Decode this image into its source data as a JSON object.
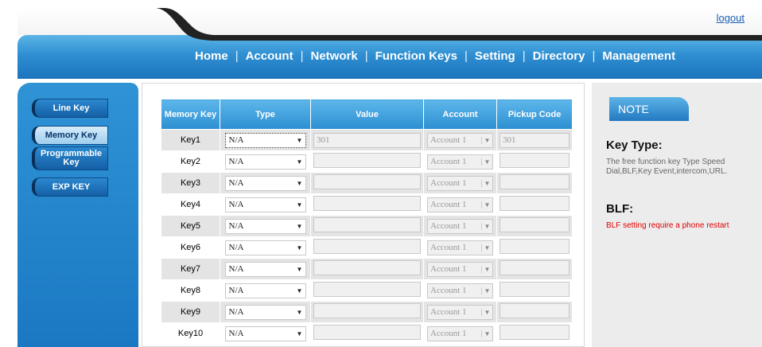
{
  "header": {
    "logout": "logout",
    "nav": [
      "Home",
      "Account",
      "Network",
      "Function Keys",
      "Setting",
      "Directory",
      "Management"
    ],
    "separator": "|"
  },
  "sidebar": {
    "items": [
      {
        "label": "Line Key",
        "active": false
      },
      {
        "label": "Memory Key",
        "active": true
      },
      {
        "label": "Programmable Key",
        "active": false
      },
      {
        "label": "EXP KEY",
        "active": false
      }
    ]
  },
  "table": {
    "headers": [
      "Memory Key",
      "Type",
      "Value",
      "Account",
      "Pickup Code"
    ],
    "rows": [
      {
        "key": "Key1",
        "type": "N/A",
        "value": "301",
        "account": "Account 1",
        "pickup": "301"
      },
      {
        "key": "Key2",
        "type": "N/A",
        "value": "",
        "account": "Account 1",
        "pickup": ""
      },
      {
        "key": "Key3",
        "type": "N/A",
        "value": "",
        "account": "Account 1",
        "pickup": ""
      },
      {
        "key": "Key4",
        "type": "N/A",
        "value": "",
        "account": "Account 1",
        "pickup": ""
      },
      {
        "key": "Key5",
        "type": "N/A",
        "value": "",
        "account": "Account 1",
        "pickup": ""
      },
      {
        "key": "Key6",
        "type": "N/A",
        "value": "",
        "account": "Account 1",
        "pickup": ""
      },
      {
        "key": "Key7",
        "type": "N/A",
        "value": "",
        "account": "Account 1",
        "pickup": ""
      },
      {
        "key": "Key8",
        "type": "N/A",
        "value": "",
        "account": "Account 1",
        "pickup": ""
      },
      {
        "key": "Key9",
        "type": "N/A",
        "value": "",
        "account": "Account 1",
        "pickup": ""
      },
      {
        "key": "Key10",
        "type": "N/A",
        "value": "",
        "account": "Account 1",
        "pickup": ""
      }
    ]
  },
  "note": {
    "tab": "NOTE",
    "key_type_title": "Key Type:",
    "key_type_text": "The free function key Type Speed Dial,BLF,Key Event,intercom,URL.",
    "blf_title": "BLF:",
    "blf_text": "BLF setting require a phone restart"
  },
  "colors": {
    "accent_blue": "#2f8fd2",
    "warning_red": "#e00000"
  }
}
